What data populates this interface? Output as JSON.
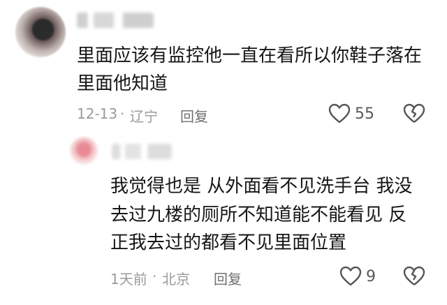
{
  "comments": [
    {
      "lines": [
        "里面应该有监控他一直在看所以你鞋子落在",
        "里面他知道"
      ],
      "date": "12-13",
      "sep": "·",
      "location": "辽宁",
      "reply_label": "回复",
      "likes": "55"
    },
    {
      "lines": [
        "我觉得也是  从外面看不见洗手台  我没",
        "去过九楼的厕所不知道能不能看见  反",
        "正我去过的都看不见里面位置"
      ],
      "date": "1天前",
      "sep": "·",
      "location": "北京",
      "reply_label": "回复",
      "likes": "9"
    }
  ]
}
